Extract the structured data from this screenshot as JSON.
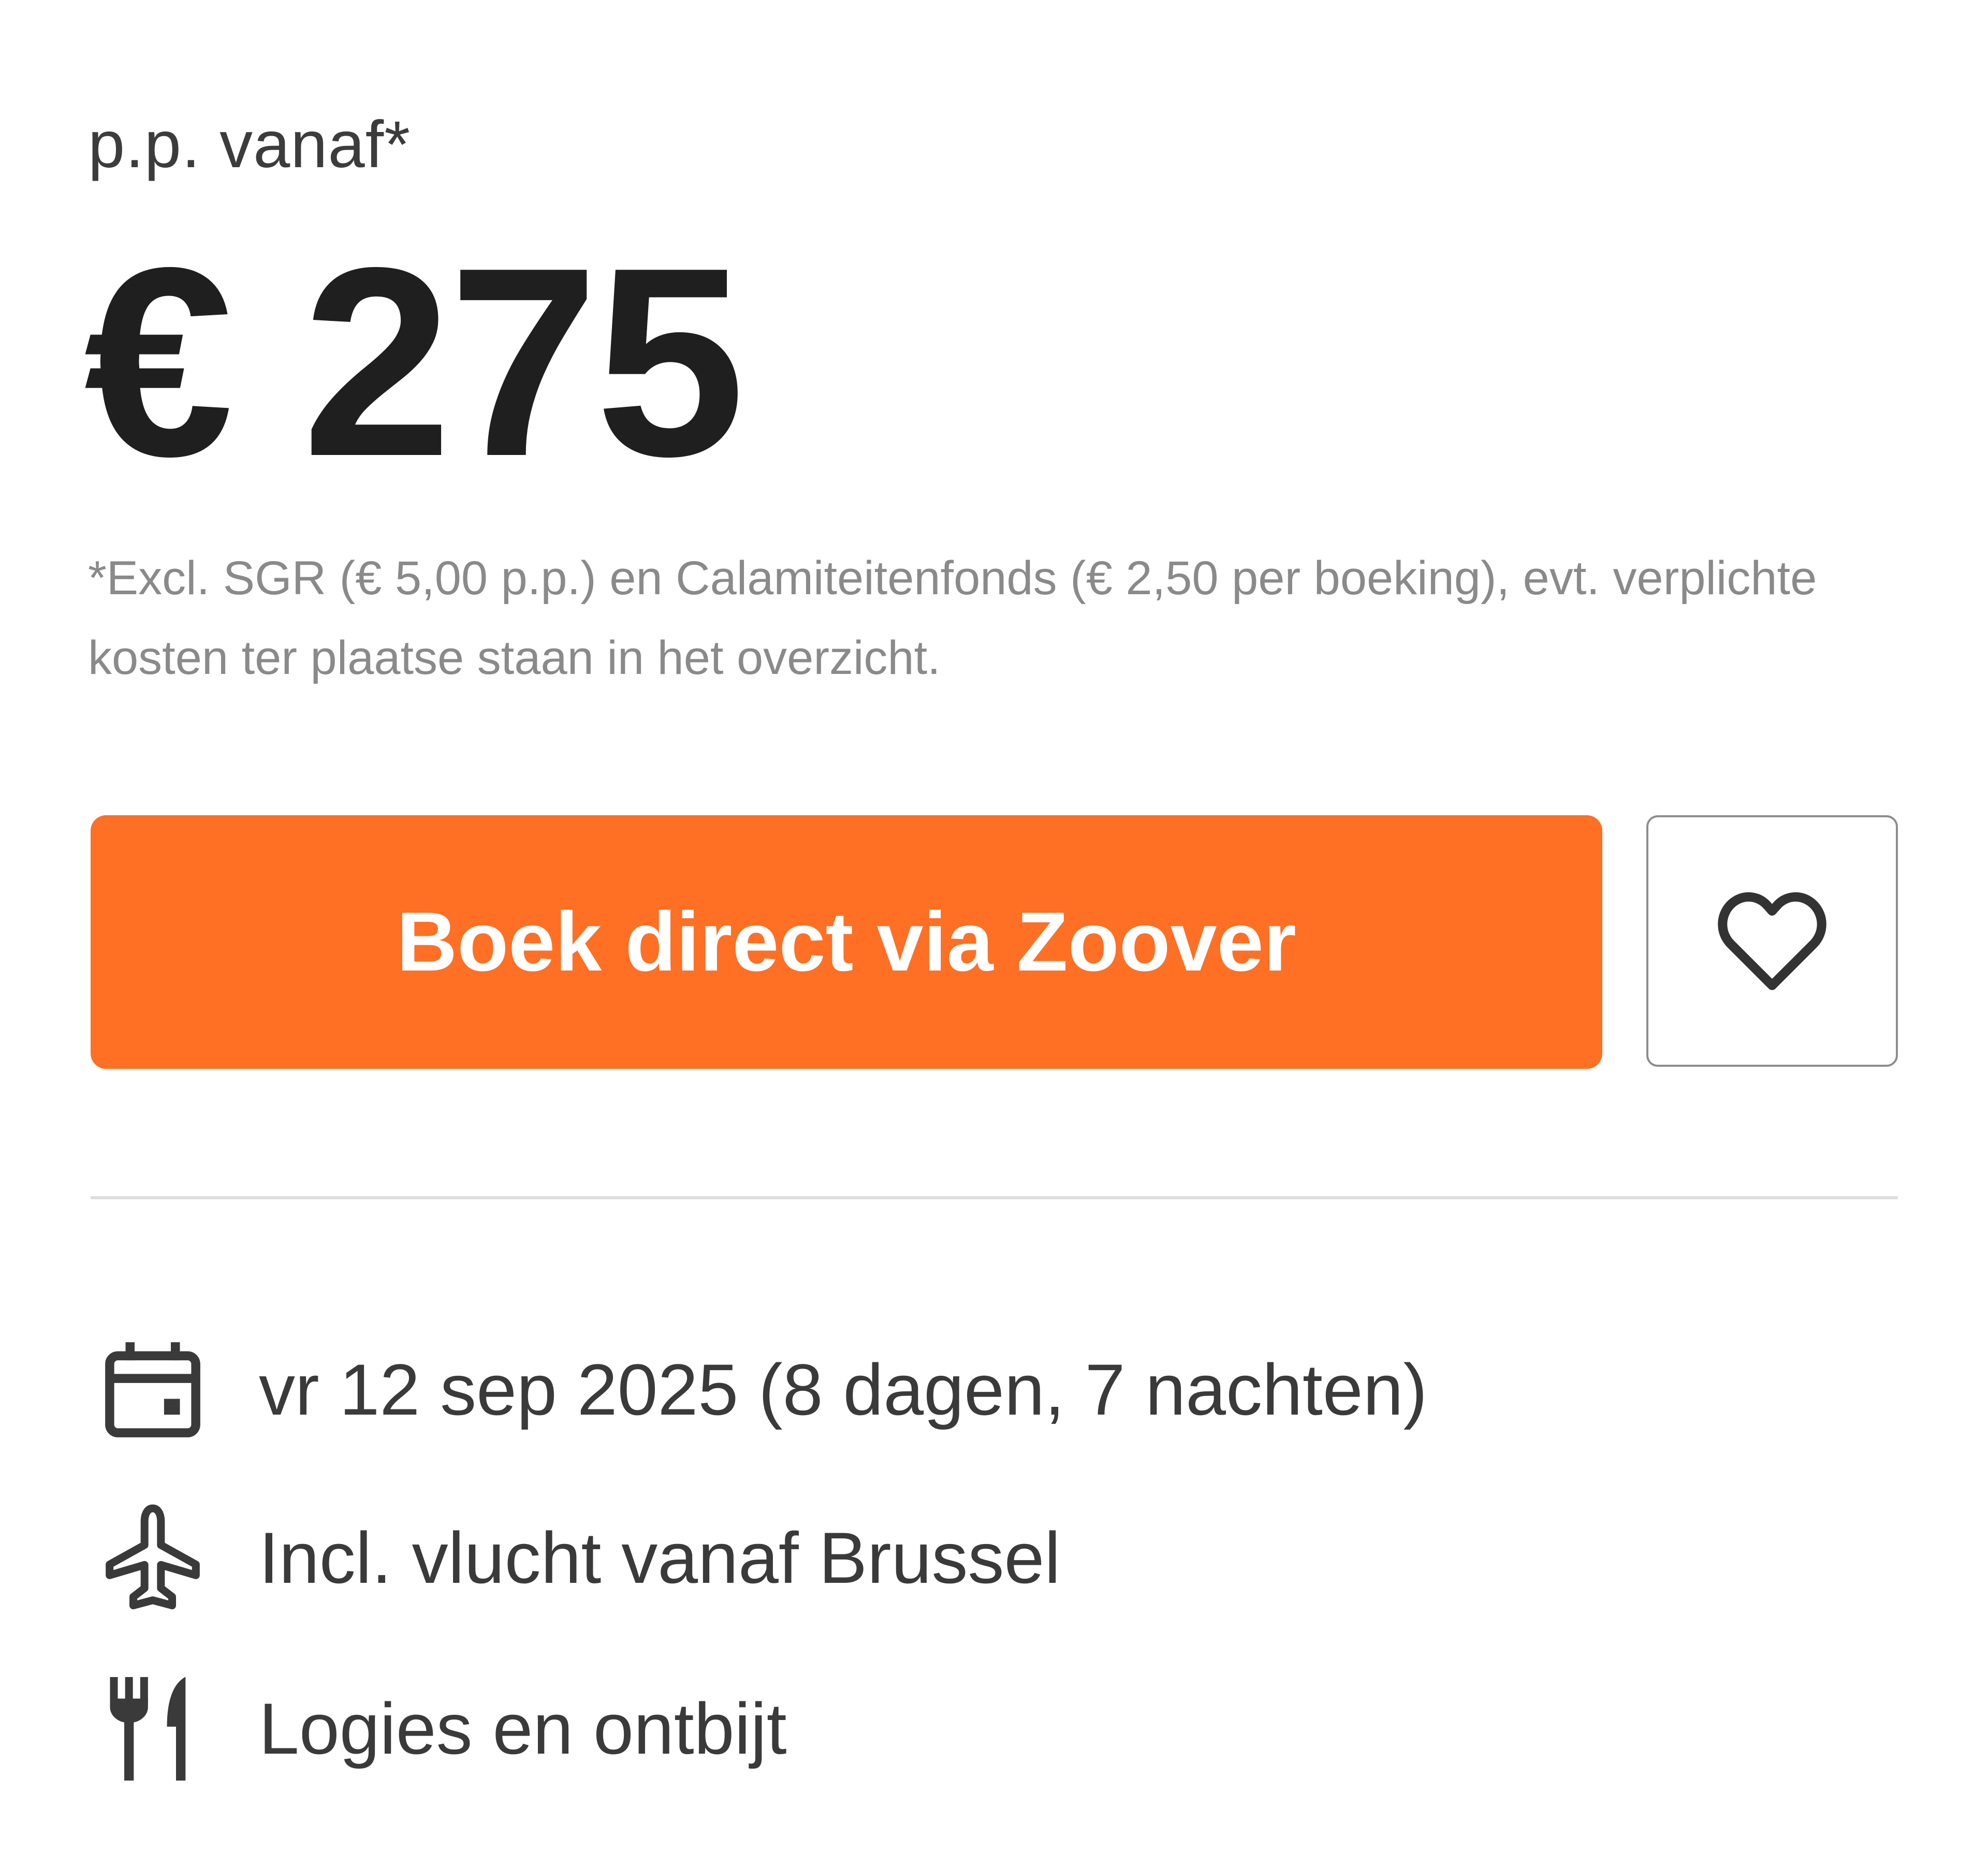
{
  "offer": {
    "price_prefix": "p.p. vanaf*",
    "price": "€ 275",
    "disclaimer": "*Excl. SGR (€ 5,00 p.p.) en Calamiteitenfonds (€ 2,50 per boeking), evt. verplichte kosten ter plaatse staan in het overzicht."
  },
  "actions": {
    "book_label": "Boek direct via Zoover",
    "favorite_icon": "heart-icon"
  },
  "details": [
    {
      "icon": "calendar-icon",
      "text": "vr 12 sep 2025 (8 dagen, 7 nachten)"
    },
    {
      "icon": "airplane-icon",
      "text": "Incl. vlucht vanaf Brussel"
    },
    {
      "icon": "fork-knife-icon",
      "text": "Logies en ontbijt"
    }
  ],
  "colors": {
    "accent": "#ff6f24",
    "text": "#2b2b2b",
    "muted": "#8a8a8a",
    "divider": "#dedede"
  }
}
